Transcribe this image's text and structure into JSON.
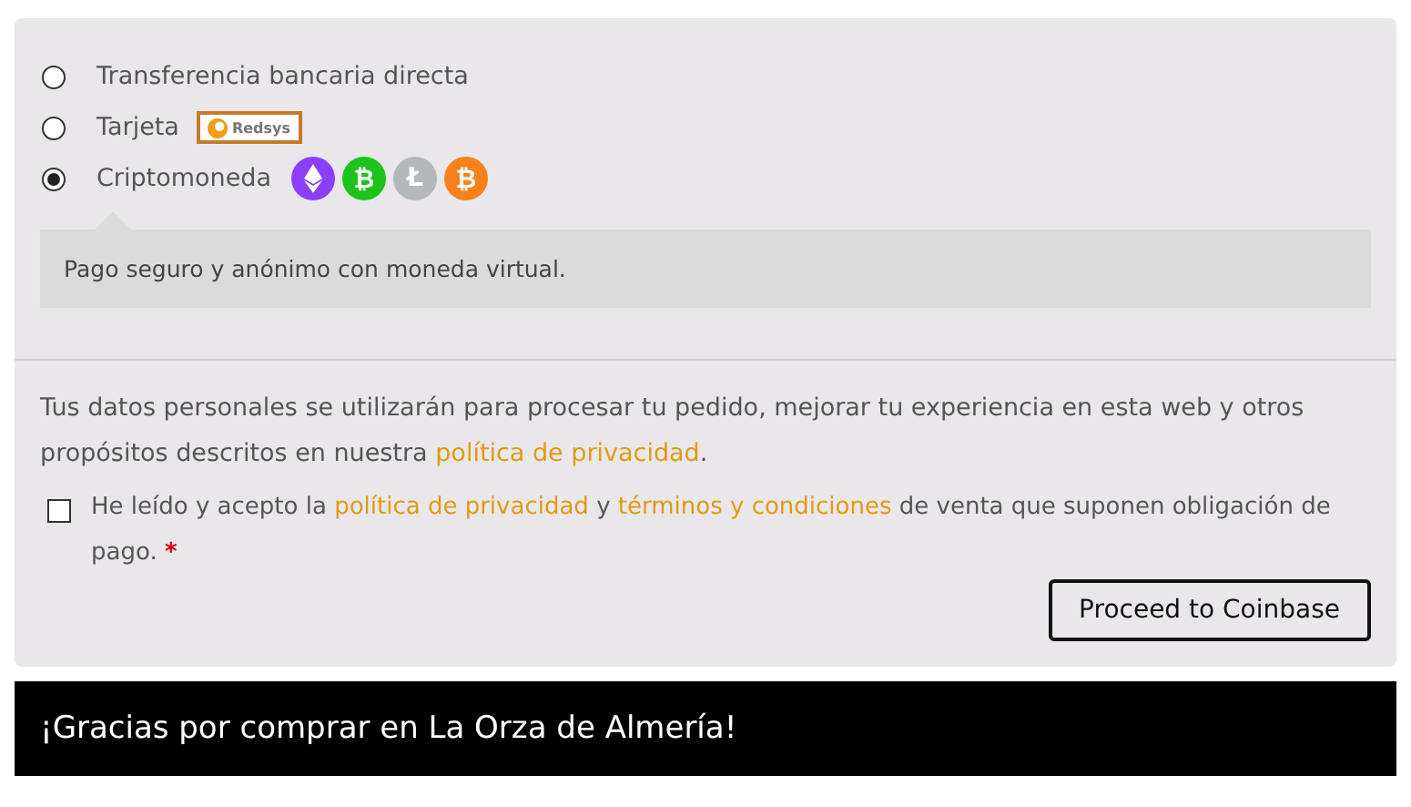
{
  "payment_methods": [
    {
      "label": "Transferencia bancaria directa",
      "selected": false,
      "kind": "plain"
    },
    {
      "label": "Tarjeta",
      "selected": false,
      "kind": "logo",
      "logo_text": "Redsys"
    },
    {
      "label": "Criptomoneda",
      "selected": true,
      "kind": "coins",
      "coins": [
        {
          "kind": "diamond",
          "color": "#8c3ffa"
        },
        {
          "kind": "glyph",
          "symbol": "₿",
          "color": "#1ec31e"
        },
        {
          "kind": "glyph",
          "symbol": "Ł",
          "color": "#b4b8bc"
        },
        {
          "kind": "glyph",
          "symbol": "₿",
          "color": "#f7821b"
        }
      ]
    }
  ],
  "method_description": "Pago seguro y anónimo con moneda virtual.",
  "privacy_notice": [
    {
      "kind": "text",
      "text": "Tus datos personales se utilizarán para procesar tu pedido, mejorar tu experiencia en esta web y otros propósitos descritos en nuestra "
    },
    {
      "kind": "link",
      "text": "política de privacidad"
    },
    {
      "kind": "text",
      "text": "."
    }
  ],
  "terms": {
    "checked": false,
    "parts": [
      {
        "kind": "text",
        "text": "He leído y acepto la "
      },
      {
        "kind": "link",
        "text": "política de privacidad"
      },
      {
        "kind": "text",
        "text": " y "
      },
      {
        "kind": "link",
        "text": "términos y condiciones"
      },
      {
        "kind": "text",
        "text": " de venta que suponen obligación de pago. "
      },
      {
        "kind": "required",
        "text": "*"
      }
    ]
  },
  "submit_button": "Proceed to Coinbase",
  "footer": "¡Gracias por comprar en La Orza de Almería!"
}
